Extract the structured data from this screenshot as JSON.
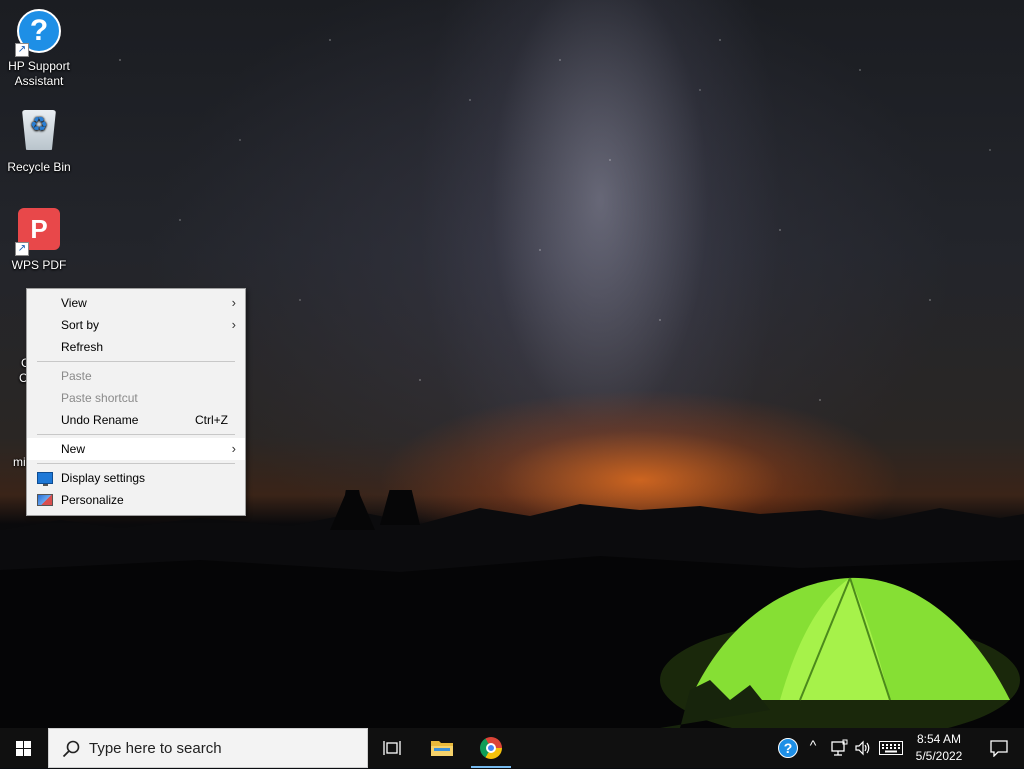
{
  "desktop": {
    "icons": [
      {
        "label_line1": "HP Support",
        "label_line2": "Assistant",
        "icon": "hp-support-icon"
      },
      {
        "label": "Recycle Bin",
        "icon": "recycle-bin-icon"
      },
      {
        "label": "WPS PDF",
        "icon": "wps-pdf-icon"
      },
      {
        "label_partial_1": "G",
        "label_partial_2": "C",
        "icon": "google-chrome-icon"
      },
      {
        "label_partial": "mi",
        "icon": "folder-icon"
      }
    ]
  },
  "context_menu": {
    "items": [
      {
        "label": "View",
        "has_submenu": true,
        "enabled": true
      },
      {
        "label": "Sort by",
        "has_submenu": true,
        "enabled": true
      },
      {
        "label": "Refresh",
        "enabled": true
      },
      {
        "label": "Paste",
        "enabled": false
      },
      {
        "label": "Paste shortcut",
        "enabled": false
      },
      {
        "label": "Undo Rename",
        "shortcut": "Ctrl+Z",
        "enabled": true
      },
      {
        "label": "New",
        "has_submenu": true,
        "enabled": true,
        "highlighted": true
      },
      {
        "label": "Display settings",
        "icon": "monitor-icon",
        "enabled": true
      },
      {
        "label": "Personalize",
        "icon": "personalize-icon",
        "enabled": true
      }
    ]
  },
  "taskbar": {
    "search_placeholder": "Type here to search",
    "pinned": [
      "task-view-icon",
      "file-explorer-icon",
      "chrome-icon"
    ],
    "tray": {
      "help_glyph": "?",
      "chevron": "^",
      "icons": [
        "network-icon",
        "volume-icon",
        "keyboard-icon"
      ]
    },
    "clock": {
      "time": "8:54 AM",
      "date": "5/5/2022"
    }
  },
  "colors": {
    "taskbar_bg": "#101010",
    "menu_bg": "#f2f2f2",
    "accent": "#1e8fe6",
    "active_indicator": "#76b9ed",
    "tent_green": "#8fe63a"
  }
}
